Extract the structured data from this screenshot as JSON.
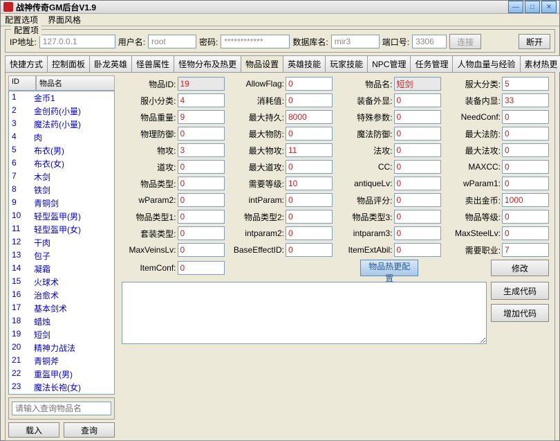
{
  "window": {
    "title": "战神传奇GM后台V1.9"
  },
  "menu": {
    "config": "配置选项",
    "style": "界面风格"
  },
  "config_group": {
    "legend": "配置项",
    "ip_label": "IP地址:",
    "ip": "127.0.0.1",
    "user_label": "用户名:",
    "user": "root",
    "pass_label": "密码:",
    "pass": "************",
    "db_label": "数据库名:",
    "db": "mir3",
    "port_label": "端口号:",
    "port": "3306",
    "connect": "连接",
    "disconnect": "断开"
  },
  "tabs": [
    "快捷方式",
    "控制面板",
    "卧龙英雄",
    "怪兽属性",
    "怪物分布及热更",
    "物品设置",
    "英雄技能",
    "玩家技能",
    "NPC管理",
    "任务管理",
    "人物血量与经验",
    "素材热更"
  ],
  "list": {
    "hdr_id": "ID",
    "hdr_name": "物品名",
    "rows": [
      {
        "id": "1",
        "name": "金币1"
      },
      {
        "id": "2",
        "name": "金创药(小量)"
      },
      {
        "id": "3",
        "name": "魔法药(小量)"
      },
      {
        "id": "4",
        "name": "肉"
      },
      {
        "id": "5",
        "name": "布衣(男)"
      },
      {
        "id": "6",
        "name": "布衣(女)"
      },
      {
        "id": "7",
        "name": "木剑"
      },
      {
        "id": "8",
        "name": "铁剑"
      },
      {
        "id": "9",
        "name": "青铜剑"
      },
      {
        "id": "10",
        "name": "轻型盔甲(男)"
      },
      {
        "id": "11",
        "name": "轻型盔甲(女)"
      },
      {
        "id": "12",
        "name": "干肉"
      },
      {
        "id": "13",
        "name": "包子"
      },
      {
        "id": "14",
        "name": "凝霜"
      },
      {
        "id": "15",
        "name": "火球术"
      },
      {
        "id": "16",
        "name": "治愈术"
      },
      {
        "id": "17",
        "name": "基本剑术"
      },
      {
        "id": "18",
        "name": "蜡烛"
      },
      {
        "id": "19",
        "name": "短剑"
      },
      {
        "id": "20",
        "name": "精神力战法"
      },
      {
        "id": "21",
        "name": "青铜斧"
      },
      {
        "id": "22",
        "name": "重盔甲(男)"
      },
      {
        "id": "23",
        "name": "魔法长袍(女)"
      }
    ]
  },
  "search": {
    "placeholder": "请输入查询物品名",
    "load": "载入",
    "query": "查询"
  },
  "form": {
    "fields": [
      {
        "l": "物品ID:",
        "v": "19",
        "ro": true
      },
      {
        "l": "AllowFlag:",
        "v": "0"
      },
      {
        "l": "物品名:",
        "v": "短剑",
        "ro": true
      },
      {
        "l": "服大分类:",
        "v": "5"
      },
      {
        "l": "服小分类:",
        "v": "4"
      },
      {
        "l": "消耗值:",
        "v": "0"
      },
      {
        "l": "装备外显:",
        "v": "0"
      },
      {
        "l": "装备内显:",
        "v": "33"
      },
      {
        "l": "物品重量:",
        "v": "9"
      },
      {
        "l": "最大持久:",
        "v": "8000"
      },
      {
        "l": "特殊参数:",
        "v": "0"
      },
      {
        "l": "NeedConf:",
        "v": "0"
      },
      {
        "l": "物理防御:",
        "v": "0"
      },
      {
        "l": "最大物防:",
        "v": "0"
      },
      {
        "l": "魔法防御:",
        "v": "0"
      },
      {
        "l": "最大法防:",
        "v": "0"
      },
      {
        "l": "物攻:",
        "v": "3"
      },
      {
        "l": "最大物攻:",
        "v": "11"
      },
      {
        "l": "法攻:",
        "v": "0"
      },
      {
        "l": "最大法攻:",
        "v": "0"
      },
      {
        "l": "道攻:",
        "v": "0"
      },
      {
        "l": "最大道攻:",
        "v": "0"
      },
      {
        "l": "CC:",
        "v": "0"
      },
      {
        "l": "MAXCC:",
        "v": "0"
      },
      {
        "l": "物品类型:",
        "v": "0"
      },
      {
        "l": "需要等级:",
        "v": "10"
      },
      {
        "l": "antiqueLv:",
        "v": "0"
      },
      {
        "l": "wParam1:",
        "v": "0"
      },
      {
        "l": "wParam2:",
        "v": "0"
      },
      {
        "l": "intParam:",
        "v": "0"
      },
      {
        "l": "物品评分:",
        "v": "0"
      },
      {
        "l": "卖出金币:",
        "v": "1000"
      },
      {
        "l": "物品类型1:",
        "v": "0"
      },
      {
        "l": "物品类型2:",
        "v": "0"
      },
      {
        "l": "物品类型3:",
        "v": "0"
      },
      {
        "l": "物品等级:",
        "v": "0"
      },
      {
        "l": "套装类型:",
        "v": "0"
      },
      {
        "l": "intparam2:",
        "v": "0"
      },
      {
        "l": "intparam3:",
        "v": "0"
      },
      {
        "l": "MaxSteelLv:",
        "v": "0"
      },
      {
        "l": "MaxVeinsLv:",
        "v": "0"
      },
      {
        "l": "BaseEffectID:",
        "v": "0"
      },
      {
        "l": "ItemExtAbil:",
        "v": "0"
      },
      {
        "l": "需要职业:",
        "v": "7"
      },
      {
        "l": "ItemConf:",
        "v": "0"
      }
    ],
    "hot_update": "物品热更配置",
    "modify": "修改",
    "gen_code": "生成代码",
    "add_code": "增加代码"
  }
}
